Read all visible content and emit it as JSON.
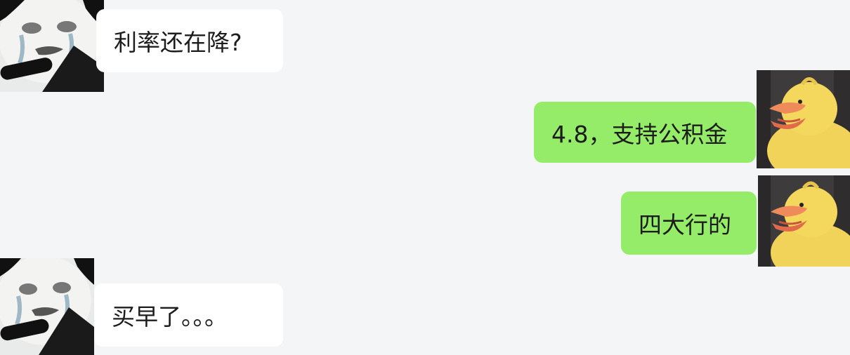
{
  "messages": [
    {
      "side": "received",
      "avatar": "panda-crying-meme-avatar",
      "text": "利率还在降?"
    },
    {
      "side": "sent",
      "avatar": "yellow-duck-avatar",
      "text": "4.8，支持公积金"
    },
    {
      "side": "sent",
      "avatar": "yellow-duck-avatar",
      "text": "四大行的"
    },
    {
      "side": "received",
      "avatar": "panda-crying-meme-avatar",
      "text": "买早了。。。"
    }
  ],
  "colors": {
    "background": "#f4f5f7",
    "received_bubble": "#ffffff",
    "sent_bubble": "#95ec69",
    "text": "#1c1c1c"
  }
}
